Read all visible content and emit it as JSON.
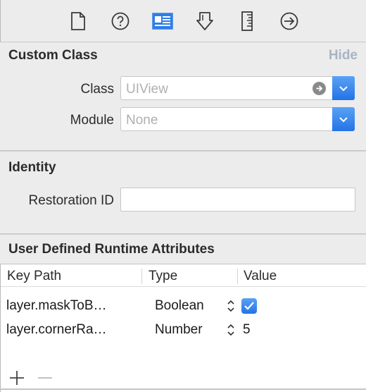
{
  "toolbar": {
    "icons": [
      "file-inspector-icon",
      "quick-help-icon",
      "identity-inspector-icon",
      "attributes-inspector-icon",
      "size-inspector-icon",
      "connections-inspector-icon"
    ],
    "selected": "identity-inspector-icon",
    "accent_color": "#2f7ee8"
  },
  "custom_class": {
    "title": "Custom Class",
    "hide_label": "Hide",
    "class_label": "Class",
    "class_value": "UIView",
    "module_label": "Module",
    "module_value": "None"
  },
  "identity": {
    "title": "Identity",
    "restoration_label": "Restoration ID",
    "restoration_value": ""
  },
  "runtime_attributes": {
    "title": "User Defined Runtime Attributes",
    "columns": [
      "Key Path",
      "Type",
      "Value"
    ],
    "rows": [
      {
        "key_path": "layer.maskToB…",
        "type": "Boolean",
        "value": "checked"
      },
      {
        "key_path": "layer.cornerRa…",
        "type": "Number",
        "value": "5"
      }
    ],
    "add_label": "+",
    "remove_label": "−"
  }
}
